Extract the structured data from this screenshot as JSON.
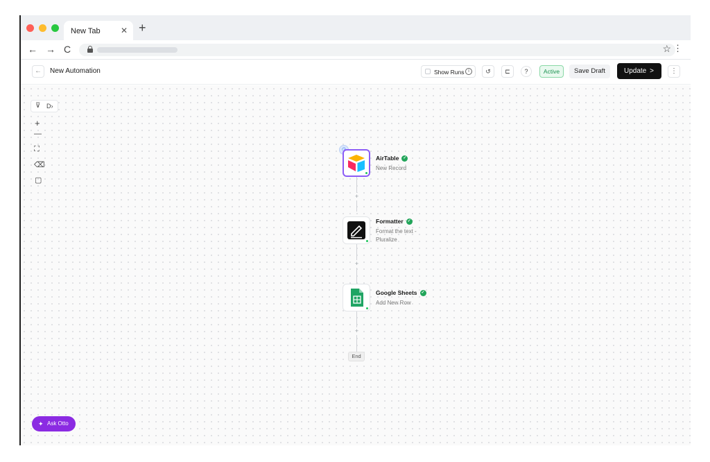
{
  "browser": {
    "tab_title": "New Tab",
    "tab_close": "✕",
    "new_tab": "+",
    "back": "←",
    "forward": "→",
    "reload": "C",
    "star": "☆",
    "menu": "⋮",
    "traffic_lights": [
      "#ff5f57",
      "#febc2e",
      "#28c840"
    ]
  },
  "header": {
    "back": "←",
    "title": "New Automation",
    "show_runs": "Show Runs",
    "info": "i",
    "history_icon": "↺",
    "structure_icon": "⊏",
    "help_icon": "?",
    "status": "Active",
    "save_draft": "Save Draft",
    "update": "Update",
    "update_chevron": ">",
    "more": "⋮"
  },
  "canvas_tools": {
    "filter": "⊽",
    "panel": "D›",
    "zoom_in": "+",
    "zoom_out": "—",
    "fit": "⛶",
    "eraser": "⌫",
    "note": "▢"
  },
  "workflow": {
    "steps": [
      {
        "title": "AirTable",
        "subtitle": "New Record",
        "icon": "airtable-icon"
      },
      {
        "title": "Formatter",
        "subtitle": "Format the text - Pluralize",
        "icon": "formatter-icon"
      },
      {
        "title": "Google Sheets",
        "subtitle": "Add New Row",
        "icon": "google-sheets-icon"
      }
    ],
    "add_step": "+",
    "end": "End",
    "check": "✓",
    "trigger_clock": "◷"
  },
  "assistant": {
    "label": "Ask Otto",
    "sparkle": "✦"
  },
  "colors": {
    "accent_purple": "#8b5cf6",
    "ask_otto": "#8b2be2",
    "active_green": "#1a9150",
    "update_black": "#111111"
  }
}
